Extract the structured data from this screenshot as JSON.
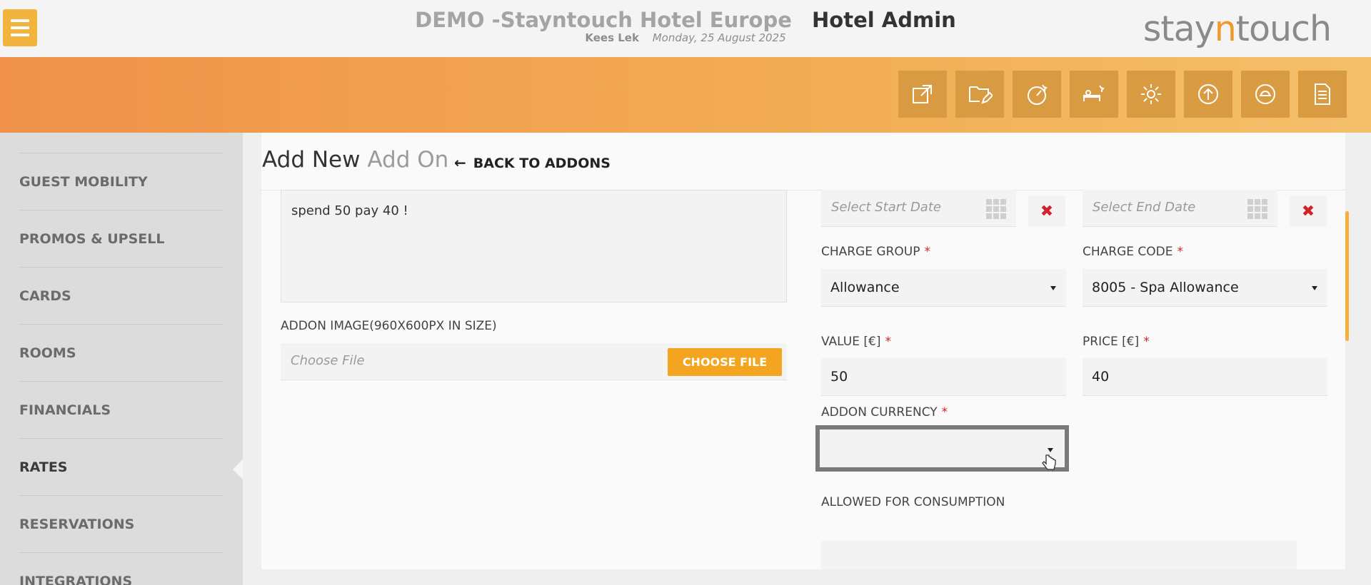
{
  "header": {
    "hotel_name": "DEMO -Stayntouch Hotel Europe",
    "section": "Hotel Admin",
    "user": "Kees Lek",
    "date": "Monday, 25 August 2025",
    "logo": {
      "part1": "stay",
      "part2": "n",
      "part3": "touch"
    }
  },
  "toolbar": {
    "icons": [
      "open-external-icon",
      "folder-edit-icon",
      "dashboard-icon",
      "housekeeping-icon",
      "settings-gear-icon",
      "upload-icon",
      "room-service-icon",
      "document-icon"
    ]
  },
  "sidebar": {
    "items": [
      {
        "label": "GUEST MOBILITY"
      },
      {
        "label": "PROMOS & UPSELL"
      },
      {
        "label": "CARDS"
      },
      {
        "label": "ROOMS"
      },
      {
        "label": "FINANCIALS"
      },
      {
        "label": "RATES",
        "active": true
      },
      {
        "label": "RESERVATIONS"
      },
      {
        "label": "INTEGRATIONS"
      }
    ]
  },
  "page": {
    "title_main": "Add New",
    "title_sub": "Add On",
    "back_label": "BACK TO ADDONS"
  },
  "form": {
    "description_value": "spend 50 pay 40 !",
    "image_label": "ADDON IMAGE(960X600PX IN SIZE)",
    "file_placeholder": "Choose File",
    "choose_file_button": "CHOOSE FILE",
    "start_date_placeholder": "Select Start Date",
    "end_date_placeholder": "Select End Date",
    "clear_symbol": "✖",
    "charge_group_label": "CHARGE GROUP",
    "charge_group_value": "Allowance",
    "charge_code_label": "CHARGE CODE",
    "charge_code_value": "8005 - Spa Allowance",
    "value_label": "VALUE [€]",
    "value_value": "50",
    "price_label": "PRICE [€]",
    "price_value": "40",
    "currency_label": "ADDON CURRENCY",
    "currency_value": "",
    "consumption_label": "ALLOWED FOR CONSUMPTION",
    "required_mark": "*"
  },
  "colors": {
    "accent_orange": "#f3a51f",
    "header_gradient_start": "#f0924a",
    "header_gradient_end": "#f4c06a",
    "required_red": "#d0242a"
  }
}
